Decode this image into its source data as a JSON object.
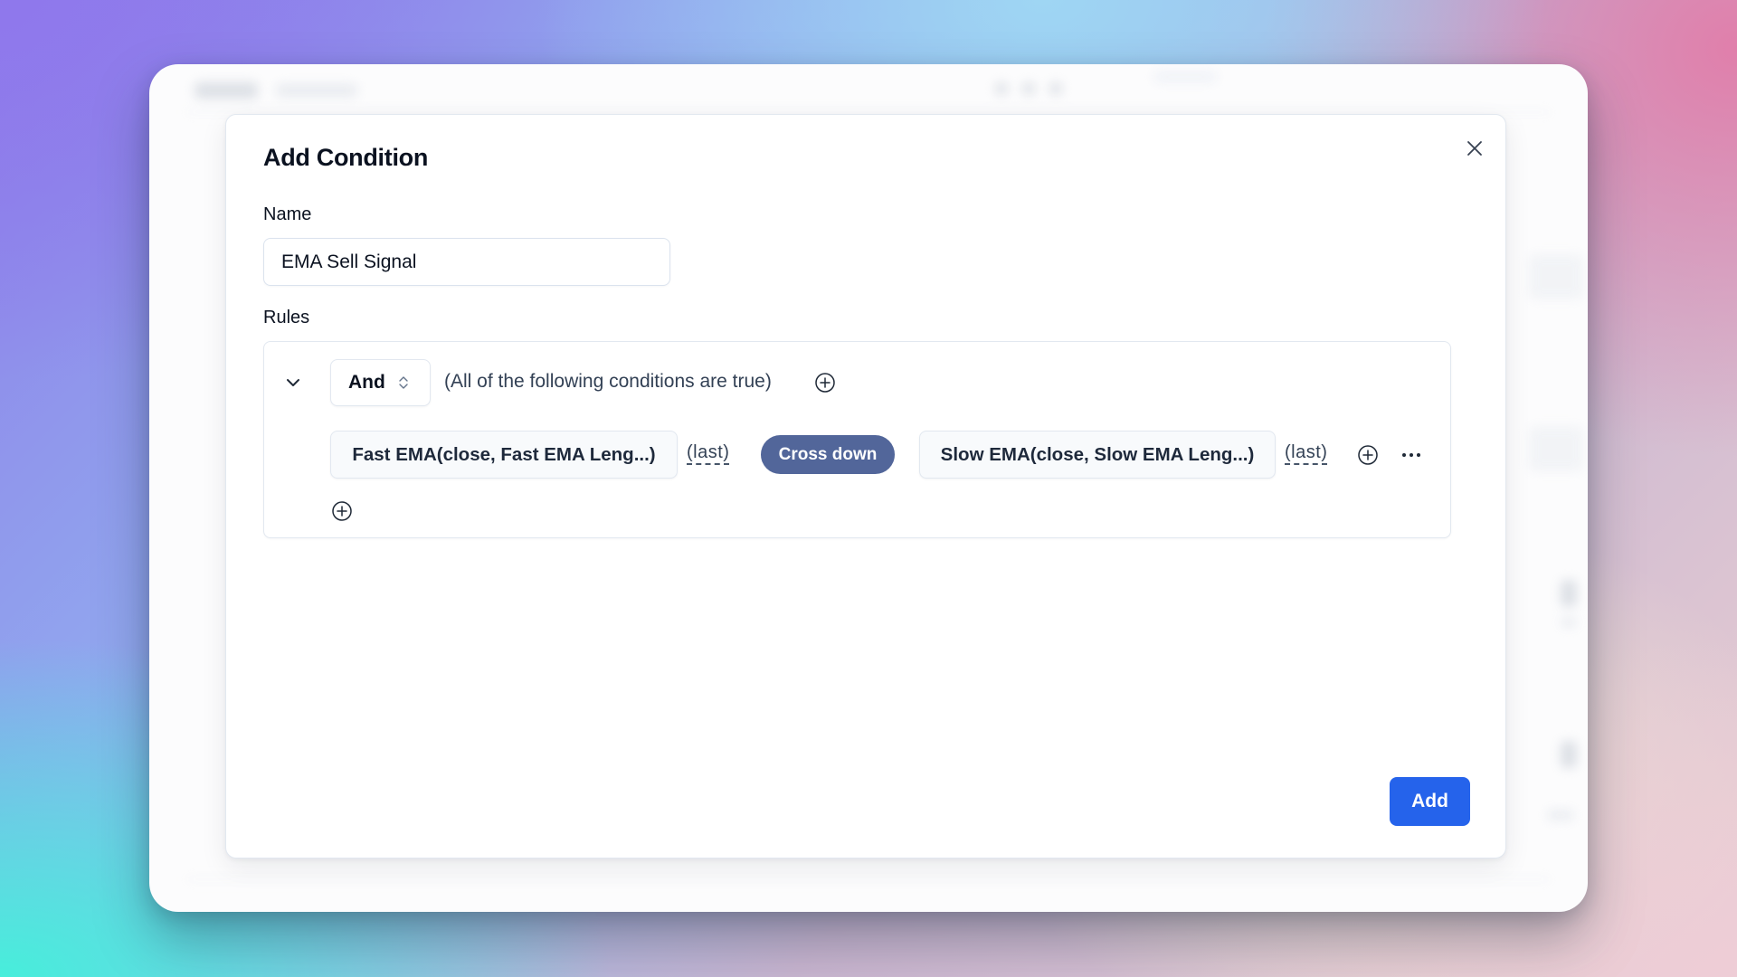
{
  "dialog": {
    "title": "Add Condition",
    "close_icon": "close-icon",
    "name_label": "Name",
    "name_value": "EMA Sell Signal",
    "rules_label": "Rules",
    "submit_label": "Add"
  },
  "rules": {
    "collapse_icon": "chevron-down-icon",
    "operator": {
      "selected": "And",
      "icon": "chevron-up-down-icon"
    },
    "description": "(All of the following conditions are true)",
    "add_condition_icon": "plus-circle-icon",
    "conditions": [
      {
        "left_operand": "Fast EMA(close, Fast EMA Leng...)",
        "left_lookback": "(last)",
        "comparator": "Cross down",
        "right_operand": "Slow EMA(close, Slow EMA Leng...)",
        "right_lookback": "(last)",
        "add_icon": "plus-circle-icon",
        "more_icon": "more-horizontal-icon"
      }
    ],
    "add_rule_icon": "plus-circle-icon"
  },
  "colors": {
    "primary": "#2563eb",
    "comparator_pill": "#52669a",
    "text": "#0b1220"
  }
}
